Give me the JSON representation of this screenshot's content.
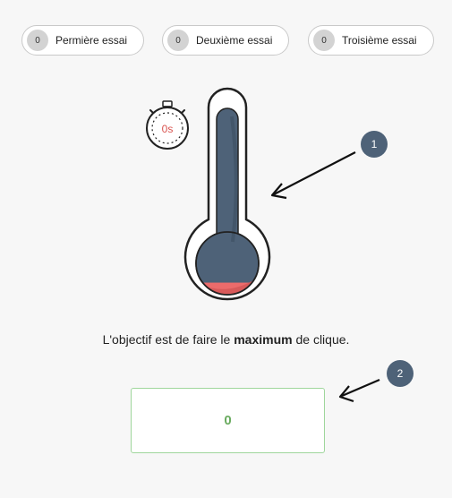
{
  "tries": [
    {
      "count": "0",
      "label": "Permière essai"
    },
    {
      "count": "0",
      "label": "Deuxième essai"
    },
    {
      "count": "0",
      "label": "Troisième essai"
    }
  ],
  "timer": {
    "value": "0s",
    "icon": "stopwatch-icon"
  },
  "thermometer": {
    "fill_level": 0.12,
    "fill_color": "#ec6b6b",
    "tube_color": "#4e6278"
  },
  "objective": {
    "prefix": "L'objectif est de faire le",
    "emphasis": "maximum",
    "suffix": "de clique."
  },
  "click_counter": {
    "value": "0"
  },
  "annotations": [
    {
      "number": "1"
    },
    {
      "number": "2"
    }
  ],
  "colors": {
    "badge": "#4e6278",
    "counter_border": "#9fd69c",
    "counter_text": "#6aab5f"
  }
}
